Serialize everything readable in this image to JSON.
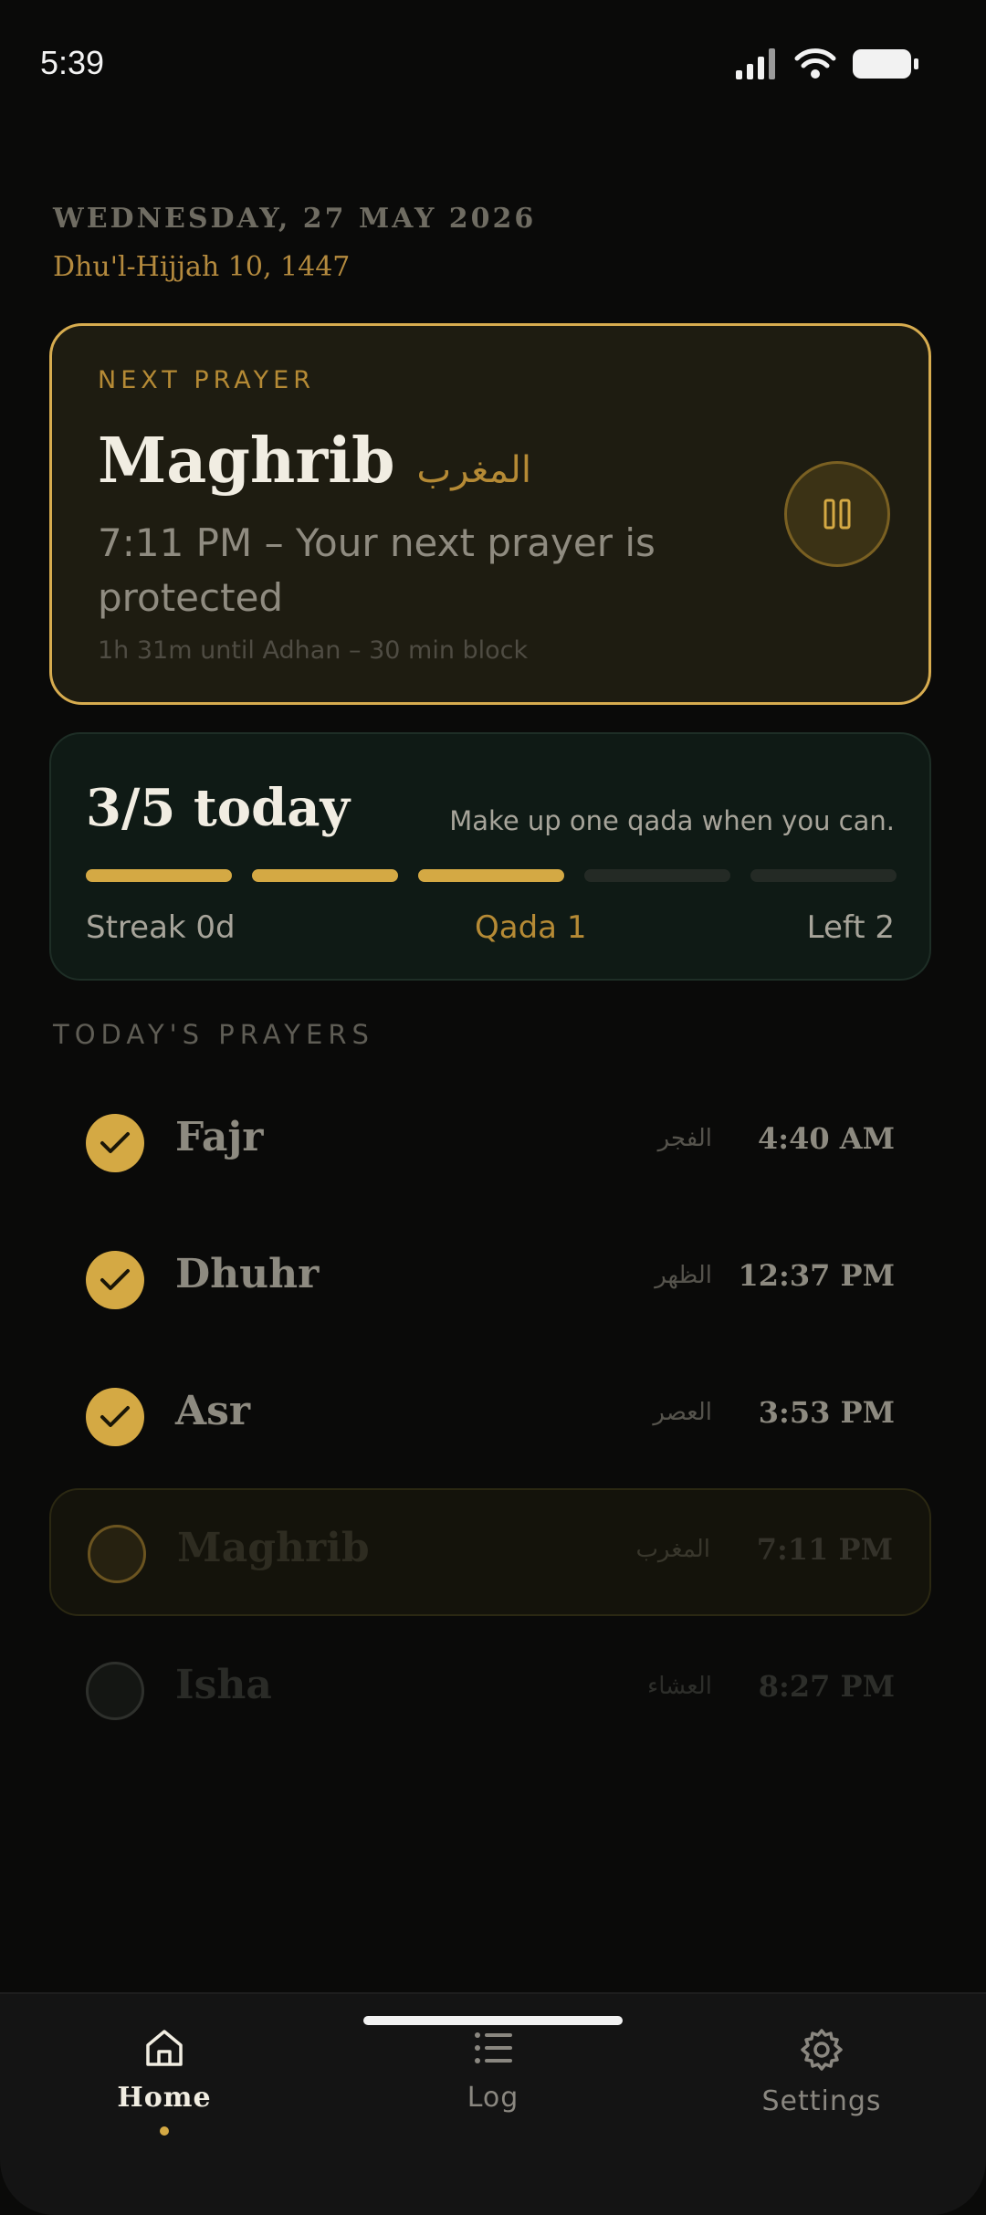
{
  "status_bar": {
    "time": "5:39"
  },
  "header": {
    "date": "WEDNESDAY, 27 MAY 2026",
    "hijri_date": "Dhu'l-Hijjah 10, 1447"
  },
  "next_prayer": {
    "label": "NEXT PRAYER",
    "name": "Maghrib",
    "arabic_name": "المغرب",
    "description": "7:11 PM – Your next prayer is protected",
    "countdown": "1h 31m until Adhan – 30 min block",
    "action_icon": "pause-icon"
  },
  "progress": {
    "title": "3/5 today",
    "hint": "Make up one qada when you can.",
    "completed": 3,
    "total": 5,
    "streak": "Streak 0d",
    "qada": "Qada 1",
    "left": "Left 2"
  },
  "todays_prayers": {
    "title": "TODAY'S PRAYERS",
    "items": [
      {
        "name": "Fajr",
        "arabic": "الفجر",
        "time": "4:40 AM",
        "state": "done"
      },
      {
        "name": "Dhuhr",
        "arabic": "الظهر",
        "time": "12:37 PM",
        "state": "done"
      },
      {
        "name": "Asr",
        "arabic": "العصر",
        "time": "3:53 PM",
        "state": "done"
      },
      {
        "name": "Maghrib",
        "arabic": "المغرب",
        "time": "7:11 PM",
        "state": "current"
      },
      {
        "name": "Isha",
        "arabic": "العشاء",
        "time": "8:27 PM",
        "state": "future"
      }
    ]
  },
  "tab_bar": {
    "tabs": [
      {
        "label": "Home",
        "icon": "home-icon",
        "active": true
      },
      {
        "label": "Log",
        "icon": "list-icon",
        "active": false
      },
      {
        "label": "Settings",
        "icon": "gear-icon",
        "active": false
      }
    ]
  },
  "colors": {
    "accent": "#d4a944",
    "background": "#0a0a09",
    "card_green": "#0f1a15"
  }
}
